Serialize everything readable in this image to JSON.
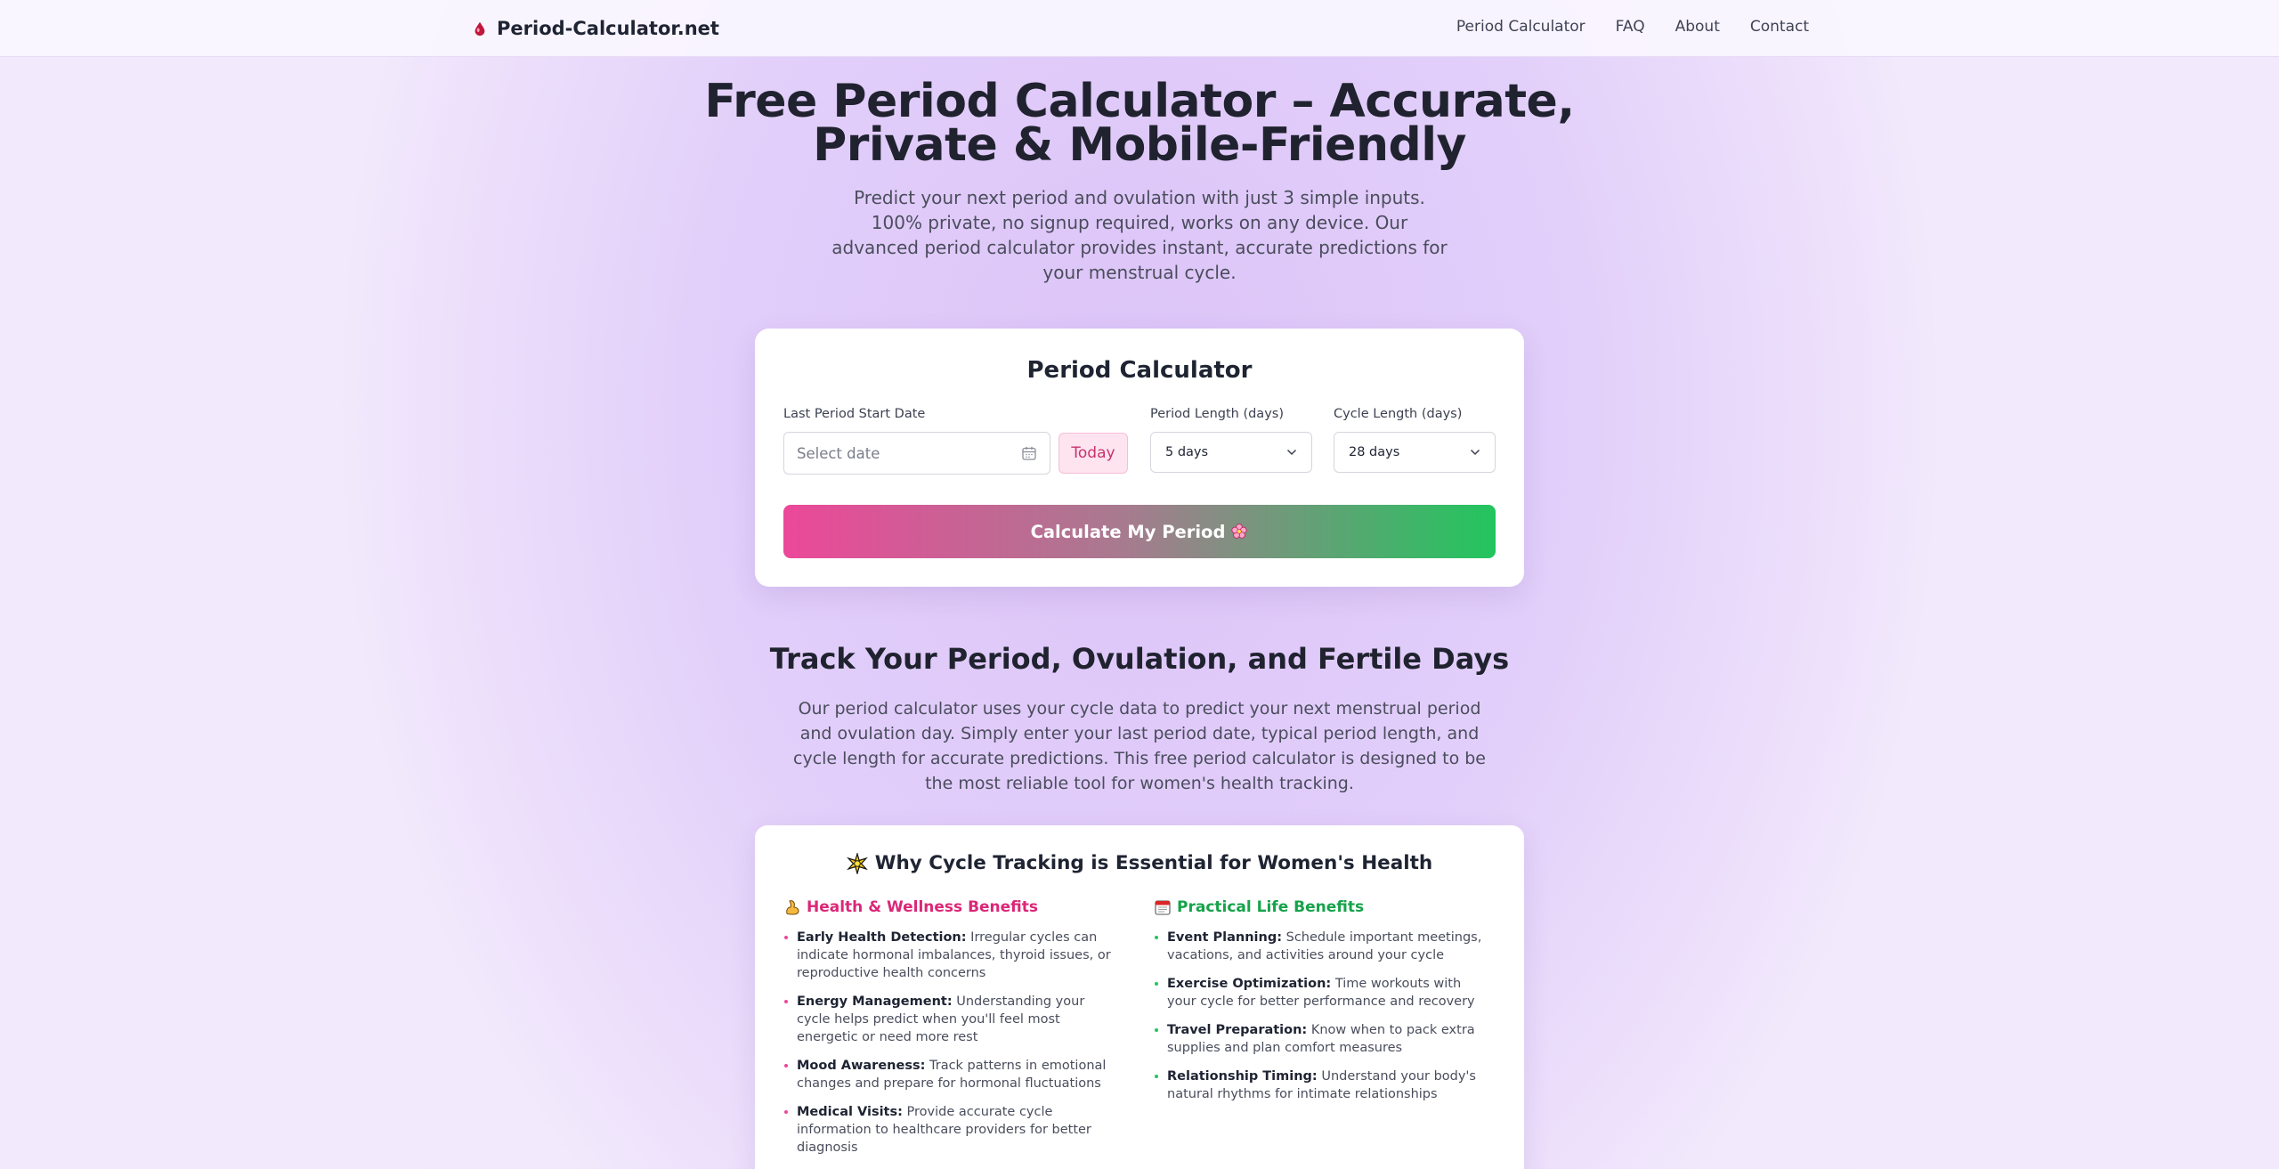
{
  "header": {
    "brand": "Period-Calculator.net",
    "nav": [
      "Period Calculator",
      "FAQ",
      "About",
      "Contact"
    ]
  },
  "hero": {
    "title_line1": "Free Period Calculator – Accurate,",
    "title_line2": "Private & Mobile-Friendly",
    "subtitle": "Predict your next period and ovulation with just 3 simple inputs. 100% private, no signup required, works on any device. Our advanced period calculator provides instant, accurate predictions for your menstrual cycle."
  },
  "calculator": {
    "title": "Period Calculator",
    "last_period_label": "Last Period Start Date",
    "date_placeholder": "Select date",
    "today_label": "Today",
    "period_length_label": "Period Length (days)",
    "period_length_value": "5 days",
    "cycle_length_label": "Cycle Length (days)",
    "cycle_length_value": "28 days",
    "submit_label": "Calculate My Period",
    "submit_icon": "flower-icon"
  },
  "tracking": {
    "title": "Track Your Period, Ovulation, and Fertile Days",
    "text": "Our period calculator uses your cycle data to predict your next menstrual period and ovulation day. Simply enter your last period date, typical period length, and cycle length for accurate predictions. This free period calculator is designed to be the most reliable tool for women's health tracking."
  },
  "why": {
    "title": "Why Cycle Tracking is Essential for Women's Health",
    "health": {
      "heading": "Health & Wellness Benefits",
      "items": [
        {
          "term": "Early Health Detection:",
          "desc": "Irregular cycles can indicate hormonal imbalances, thyroid issues, or reproductive health concerns"
        },
        {
          "term": "Energy Management:",
          "desc": "Understanding your cycle helps predict when you'll feel most energetic or need more rest"
        },
        {
          "term": "Mood Awareness:",
          "desc": "Track patterns in emotional changes and prepare for hormonal fluctuations"
        },
        {
          "term": "Medical Visits:",
          "desc": "Provide accurate cycle information to healthcare providers for better diagnosis"
        }
      ]
    },
    "practical": {
      "heading": "Practical Life Benefits",
      "items": [
        {
          "term": "Event Planning:",
          "desc": "Schedule important meetings, vacations, and activities around your cycle"
        },
        {
          "term": "Exercise Optimization:",
          "desc": "Time workouts with your cycle for better performance and recovery"
        },
        {
          "term": "Travel Preparation:",
          "desc": "Know when to pack extra supplies and plan comfort measures"
        },
        {
          "term": "Relationship Timing:",
          "desc": "Understand your body's natural rhythms for intimate relationships"
        }
      ]
    }
  },
  "colors": {
    "accent_pink": "#ec4899",
    "accent_green": "#22c55e",
    "heading_pink": "#db2777",
    "heading_green": "#16a34a"
  }
}
